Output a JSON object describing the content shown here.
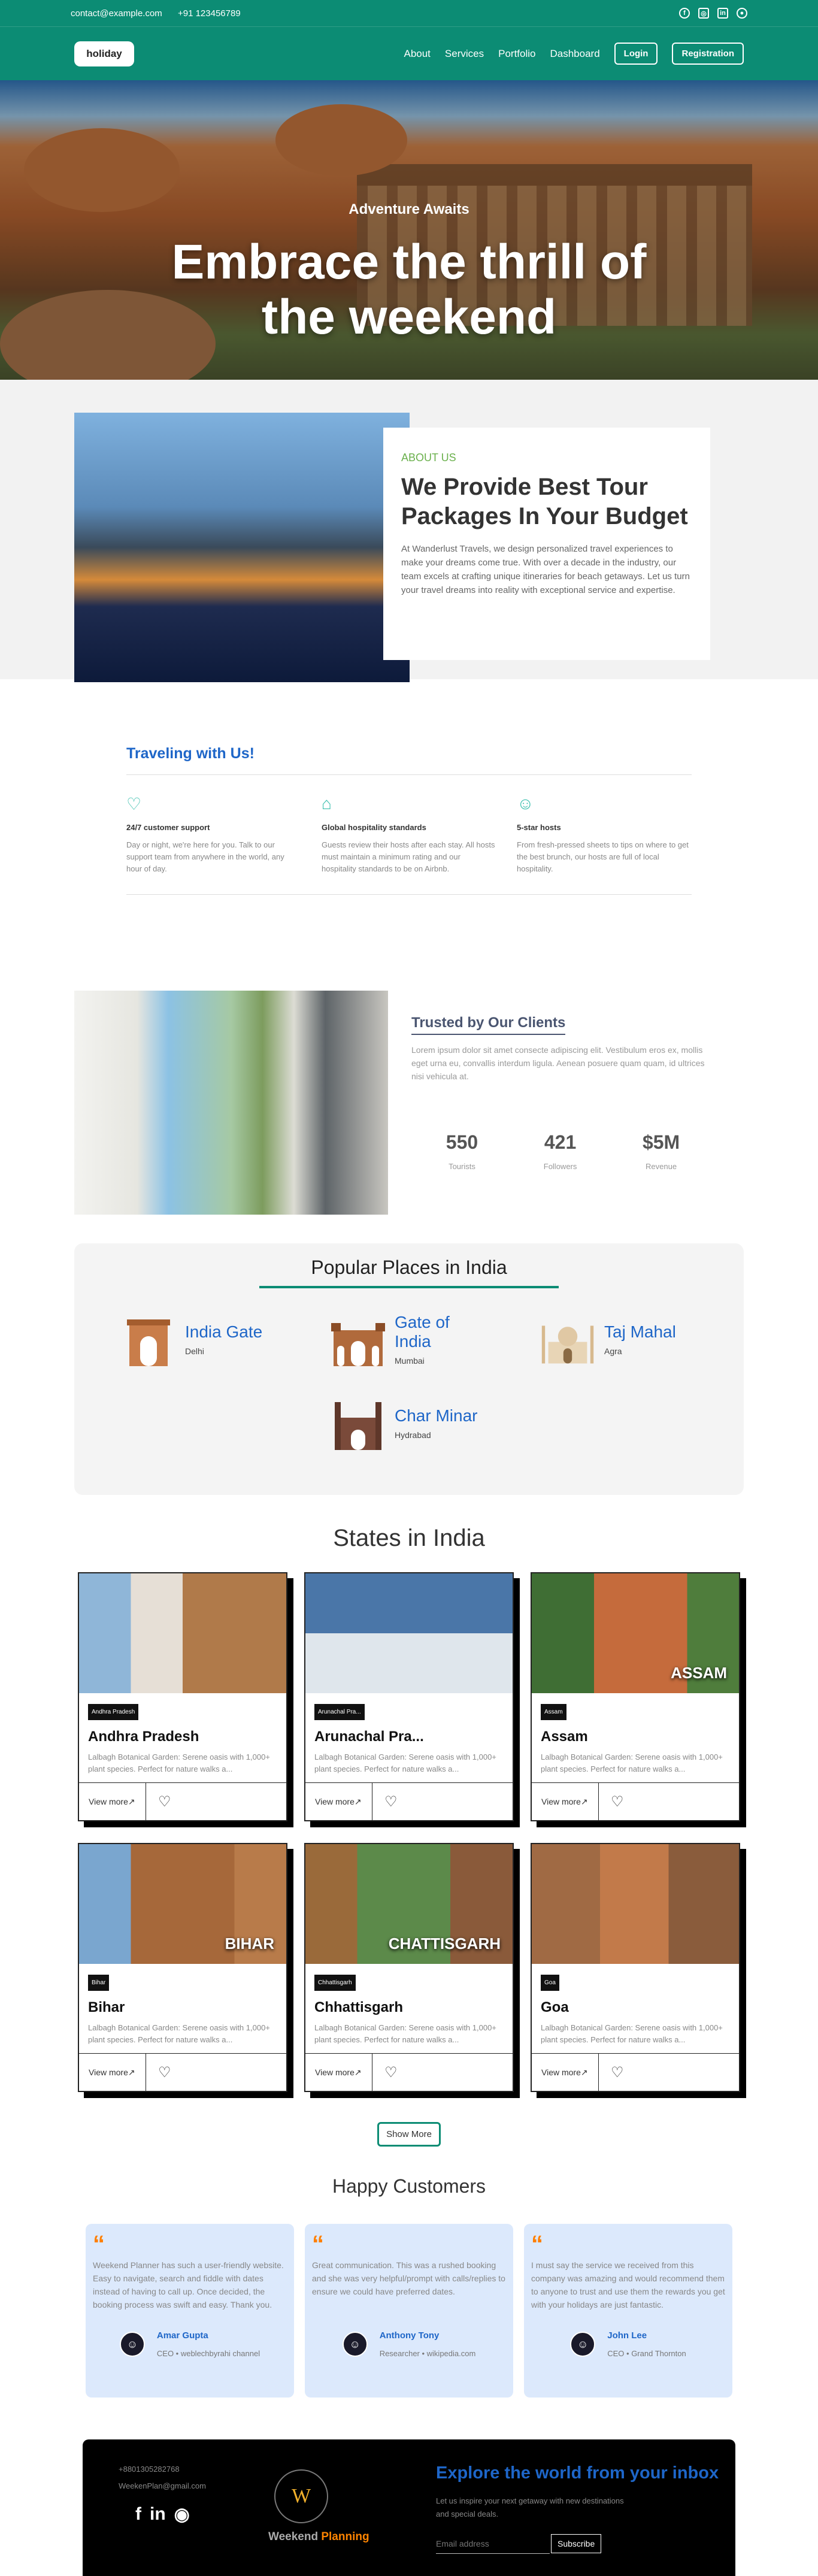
{
  "topbar": {
    "email": "contact@example.com",
    "phone": "+91 123456789",
    "icons": [
      "facebook-icon",
      "instagram-icon",
      "linkedin-icon",
      "github-icon"
    ]
  },
  "nav": {
    "logo": "holiday",
    "links": [
      "About",
      "Services",
      "Portfolio",
      "Dashboard"
    ],
    "login": "Login",
    "register": "Registration"
  },
  "hero": {
    "subtitle": "Adventure Awaits",
    "title_line1": "Embrace the thrill of",
    "title_line2": "the weekend"
  },
  "about": {
    "label": "ABOUT US",
    "title": "We Provide Best Tour Packages In Your Budget",
    "text": "At Wanderlust Travels, we design personalized travel experiences to make your dreams come true. With over a decade in the industry, our team excels at crafting unique itineraries for beach getaways. Let us turn your travel dreams into reality with exceptional service and expertise."
  },
  "travel": {
    "title": "Traveling with Us!",
    "features": [
      {
        "title": "24/7 customer support",
        "text": "Day or night, we're here for you. Talk to our support team from anywhere in the world, any hour of day."
      },
      {
        "title": "Global hospitality standards",
        "text": "Guests review their hosts after each stay. All hosts must maintain a minimum rating and our hospitality standards to be on Airbnb."
      },
      {
        "title": "5-star hosts",
        "text": "From fresh-pressed sheets to tips on where to get the best brunch, our hosts are full of local hospitality."
      }
    ]
  },
  "trust": {
    "title": "Trusted by Our Clients",
    "text": "Lorem ipsum dolor sit amet consecte adipiscing elit. Vestibulum eros ex, mollis eget urna eu, convallis interdum ligula. Aenean posuere quam quam, id ultrices nisi vehicula at.",
    "stats": [
      {
        "value": "550",
        "label": "Tourists"
      },
      {
        "value": "421",
        "label": "Followers"
      },
      {
        "value": "$5M",
        "label": "Revenue"
      }
    ]
  },
  "popular": {
    "title": "Popular Places in India",
    "places": [
      {
        "name": "India Gate",
        "city": "Delhi"
      },
      {
        "name": "Gate of India",
        "city": "Mumbai"
      },
      {
        "name": "Taj Mahal",
        "city": "Agra"
      },
      {
        "name": "Char Minar",
        "city": "Hydrabad"
      }
    ]
  },
  "states": {
    "title": "States in India",
    "cards": [
      {
        "name": "Andhra Pradesh",
        "badge": "Andhra Pradesh",
        "overlay": "",
        "desc": "Lalbagh Botanical Garden: Serene oasis with 1,000+ plant species. Perfect for nature walks a..."
      },
      {
        "name": "Arunachal Pra...",
        "badge": "Arunachal Pra...",
        "overlay": "",
        "desc": "Lalbagh Botanical Garden: Serene oasis with 1,000+ plant species. Perfect for nature walks a..."
      },
      {
        "name": "Assam",
        "badge": "Assam",
        "overlay": "ASSAM",
        "desc": "Lalbagh Botanical Garden: Serene oasis with 1,000+ plant species. Perfect for nature walks a..."
      },
      {
        "name": "Bihar",
        "badge": "Bihar",
        "overlay": "BIHAR",
        "desc": "Lalbagh Botanical Garden: Serene oasis with 1,000+ plant species. Perfect for nature walks a..."
      },
      {
        "name": "Chhattisgarh",
        "badge": "Chhattisgarh",
        "overlay": "CHATTISGARH",
        "desc": "Lalbagh Botanical Garden: Serene oasis with 1,000+ plant species. Perfect for nature walks a..."
      },
      {
        "name": "Goa",
        "badge": "Goa",
        "overlay": "",
        "desc": "Lalbagh Botanical Garden: Serene oasis with 1,000+ plant species. Perfect for nature walks a..."
      }
    ],
    "view_more": "View more",
    "show_more": "Show More"
  },
  "happy": {
    "title": "Happy Customers",
    "items": [
      {
        "text": "Weekend Planner has such a user-friendly website. Easy to navigate, search and fiddle with dates instead of having to call up. Once decided, the booking process was swift and easy. Thank you.",
        "name": "Amar Gupta",
        "role": "CEO • weblechbyrahi channel"
      },
      {
        "text": "Great communication. This was a rushed booking and she was very helpful/prompt with calls/replies to ensure we could have preferred dates.",
        "name": "Anthony Tony",
        "role": "Researcher • wikipedia.com"
      },
      {
        "text": "I must say the service we received from this company was amazing and would recommend them to anyone to trust and use them the rewards you get with your holidays are just fantastic.",
        "name": "John Lee",
        "role": "CEO • Grand Thornton"
      }
    ]
  },
  "footer": {
    "phone": "+8801305282768",
    "email": "WeekenPlan@gmail.com",
    "logo_letter": "W",
    "brand_w": "Weekend",
    "brand_p": "Planning",
    "heading": "Explore the world from your inbox",
    "text": "Let us inspire your next getaway with new destinations and special deals.",
    "email_placeholder": "Email address",
    "subscribe": "Subscribe"
  },
  "colors": {
    "primary": "#0c8c74",
    "link": "#1e66c8",
    "accent": "#ff7f00"
  }
}
